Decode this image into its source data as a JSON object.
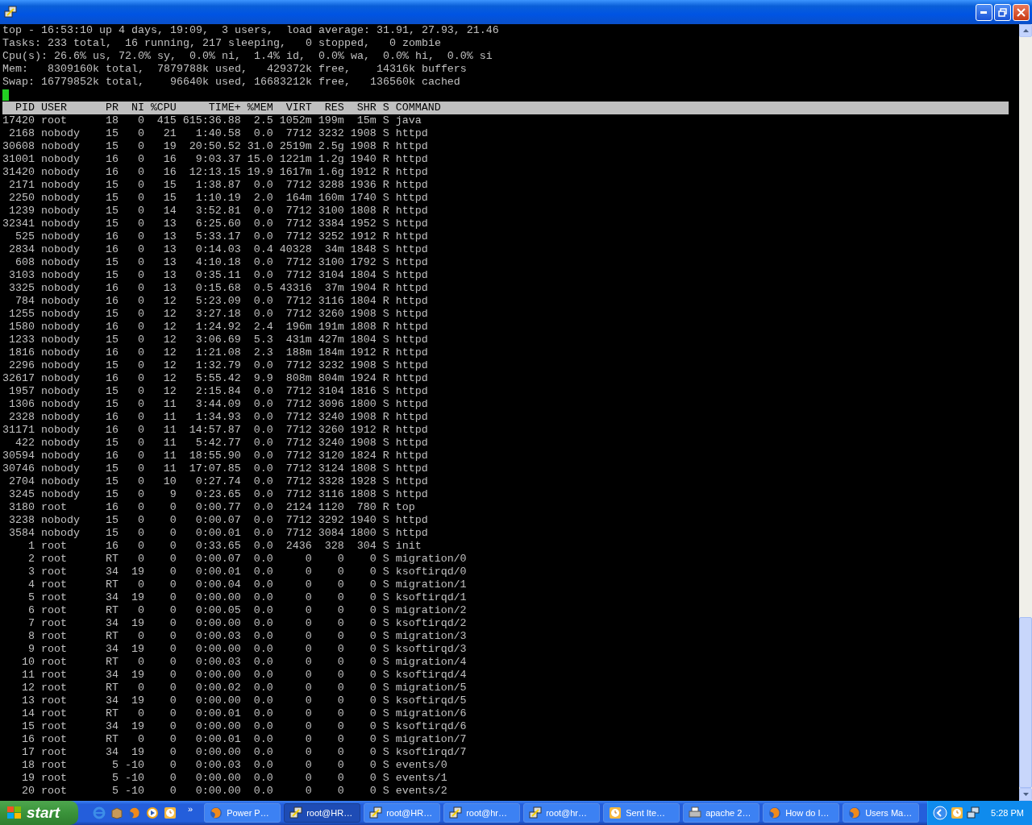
{
  "terminal": {
    "summary": [
      "top - 16:53:10 up 4 days, 19:09,  3 users,  load average: 31.91, 27.93, 21.46",
      "Tasks: 233 total,  16 running, 217 sleeping,   0 stopped,   0 zombie",
      "Cpu(s): 26.6% us, 72.0% sy,  0.0% ni,  1.4% id,  0.0% wa,  0.0% hi,  0.0% si",
      "Mem:   8309160k total,  7879788k used,   429372k free,    14316k buffers",
      "Swap: 16779852k total,    96640k used, 16683212k free,   136560k cached"
    ],
    "table": {
      "columns": [
        "PID",
        "USER",
        "PR",
        "NI",
        "%CPU",
        "TIME+",
        "%MEM",
        "VIRT",
        "RES",
        "SHR",
        "S",
        "COMMAND"
      ],
      "rows": [
        [
          "17420",
          "root",
          "18",
          "0",
          "415",
          "615:36.88",
          "2.5",
          "1052m",
          "199m",
          "15m",
          "S",
          "java"
        ],
        [
          "2168",
          "nobody",
          "15",
          "0",
          "21",
          "1:40.58",
          "0.0",
          "7712",
          "3232",
          "1908",
          "S",
          "httpd"
        ],
        [
          "30608",
          "nobody",
          "15",
          "0",
          "19",
          "20:50.52",
          "31.0",
          "2519m",
          "2.5g",
          "1908",
          "R",
          "httpd"
        ],
        [
          "31001",
          "nobody",
          "16",
          "0",
          "16",
          "9:03.37",
          "15.0",
          "1221m",
          "1.2g",
          "1940",
          "R",
          "httpd"
        ],
        [
          "31420",
          "nobody",
          "16",
          "0",
          "16",
          "12:13.15",
          "19.9",
          "1617m",
          "1.6g",
          "1912",
          "R",
          "httpd"
        ],
        [
          "2171",
          "nobody",
          "15",
          "0",
          "15",
          "1:38.87",
          "0.0",
          "7712",
          "3288",
          "1936",
          "R",
          "httpd"
        ],
        [
          "2250",
          "nobody",
          "15",
          "0",
          "15",
          "1:10.19",
          "2.0",
          "164m",
          "160m",
          "1740",
          "S",
          "httpd"
        ],
        [
          "1239",
          "nobody",
          "15",
          "0",
          "14",
          "3:52.81",
          "0.0",
          "7712",
          "3100",
          "1808",
          "R",
          "httpd"
        ],
        [
          "32341",
          "nobody",
          "15",
          "0",
          "13",
          "6:25.60",
          "0.0",
          "7712",
          "3384",
          "1952",
          "S",
          "httpd"
        ],
        [
          "525",
          "nobody",
          "16",
          "0",
          "13",
          "5:33.17",
          "0.0",
          "7712",
          "3252",
          "1912",
          "R",
          "httpd"
        ],
        [
          "2834",
          "nobody",
          "16",
          "0",
          "13",
          "0:14.03",
          "0.4",
          "40328",
          "34m",
          "1848",
          "S",
          "httpd"
        ],
        [
          "608",
          "nobody",
          "15",
          "0",
          "13",
          "4:10.18",
          "0.0",
          "7712",
          "3100",
          "1792",
          "S",
          "httpd"
        ],
        [
          "3103",
          "nobody",
          "15",
          "0",
          "13",
          "0:35.11",
          "0.0",
          "7712",
          "3104",
          "1804",
          "S",
          "httpd"
        ],
        [
          "3325",
          "nobody",
          "16",
          "0",
          "13",
          "0:15.68",
          "0.5",
          "43316",
          "37m",
          "1904",
          "R",
          "httpd"
        ],
        [
          "784",
          "nobody",
          "16",
          "0",
          "12",
          "5:23.09",
          "0.0",
          "7712",
          "3116",
          "1804",
          "R",
          "httpd"
        ],
        [
          "1255",
          "nobody",
          "15",
          "0",
          "12",
          "3:27.18",
          "0.0",
          "7712",
          "3260",
          "1908",
          "S",
          "httpd"
        ],
        [
          "1580",
          "nobody",
          "16",
          "0",
          "12",
          "1:24.92",
          "2.4",
          "196m",
          "191m",
          "1808",
          "R",
          "httpd"
        ],
        [
          "1233",
          "nobody",
          "15",
          "0",
          "12",
          "3:06.69",
          "5.3",
          "431m",
          "427m",
          "1804",
          "S",
          "httpd"
        ],
        [
          "1816",
          "nobody",
          "16",
          "0",
          "12",
          "1:21.08",
          "2.3",
          "188m",
          "184m",
          "1912",
          "R",
          "httpd"
        ],
        [
          "2296",
          "nobody",
          "15",
          "0",
          "12",
          "1:32.79",
          "0.0",
          "7712",
          "3232",
          "1908",
          "S",
          "httpd"
        ],
        [
          "32617",
          "nobody",
          "16",
          "0",
          "12",
          "5:55.42",
          "9.9",
          "808m",
          "804m",
          "1924",
          "R",
          "httpd"
        ],
        [
          "1957",
          "nobody",
          "15",
          "0",
          "12",
          "2:15.84",
          "0.0",
          "7712",
          "3104",
          "1816",
          "S",
          "httpd"
        ],
        [
          "1306",
          "nobody",
          "15",
          "0",
          "11",
          "3:44.09",
          "0.0",
          "7712",
          "3096",
          "1800",
          "S",
          "httpd"
        ],
        [
          "2328",
          "nobody",
          "16",
          "0",
          "11",
          "1:34.93",
          "0.0",
          "7712",
          "3240",
          "1908",
          "R",
          "httpd"
        ],
        [
          "31171",
          "nobody",
          "16",
          "0",
          "11",
          "14:57.87",
          "0.0",
          "7712",
          "3260",
          "1912",
          "R",
          "httpd"
        ],
        [
          "422",
          "nobody",
          "15",
          "0",
          "11",
          "5:42.77",
          "0.0",
          "7712",
          "3240",
          "1908",
          "S",
          "httpd"
        ],
        [
          "30594",
          "nobody",
          "16",
          "0",
          "11",
          "18:55.90",
          "0.0",
          "7712",
          "3120",
          "1824",
          "R",
          "httpd"
        ],
        [
          "30746",
          "nobody",
          "15",
          "0",
          "11",
          "17:07.85",
          "0.0",
          "7712",
          "3124",
          "1808",
          "S",
          "httpd"
        ],
        [
          "2704",
          "nobody",
          "15",
          "0",
          "10",
          "0:27.74",
          "0.0",
          "7712",
          "3328",
          "1928",
          "S",
          "httpd"
        ],
        [
          "3245",
          "nobody",
          "15",
          "0",
          "9",
          "0:23.65",
          "0.0",
          "7712",
          "3116",
          "1808",
          "S",
          "httpd"
        ],
        [
          "3180",
          "root",
          "16",
          "0",
          "0",
          "0:00.77",
          "0.0",
          "2124",
          "1120",
          "780",
          "R",
          "top"
        ],
        [
          "3238",
          "nobody",
          "15",
          "0",
          "0",
          "0:00.07",
          "0.0",
          "7712",
          "3292",
          "1940",
          "S",
          "httpd"
        ],
        [
          "3584",
          "nobody",
          "15",
          "0",
          "0",
          "0:00.01",
          "0.0",
          "7712",
          "3084",
          "1800",
          "S",
          "httpd"
        ],
        [
          "1",
          "root",
          "16",
          "0",
          "0",
          "0:33.65",
          "0.0",
          "2436",
          "328",
          "304",
          "S",
          "init"
        ],
        [
          "2",
          "root",
          "RT",
          "0",
          "0",
          "0:00.07",
          "0.0",
          "0",
          "0",
          "0",
          "S",
          "migration/0"
        ],
        [
          "3",
          "root",
          "34",
          "19",
          "0",
          "0:00.01",
          "0.0",
          "0",
          "0",
          "0",
          "S",
          "ksoftirqd/0"
        ],
        [
          "4",
          "root",
          "RT",
          "0",
          "0",
          "0:00.04",
          "0.0",
          "0",
          "0",
          "0",
          "S",
          "migration/1"
        ],
        [
          "5",
          "root",
          "34",
          "19",
          "0",
          "0:00.00",
          "0.0",
          "0",
          "0",
          "0",
          "S",
          "ksoftirqd/1"
        ],
        [
          "6",
          "root",
          "RT",
          "0",
          "0",
          "0:00.05",
          "0.0",
          "0",
          "0",
          "0",
          "S",
          "migration/2"
        ],
        [
          "7",
          "root",
          "34",
          "19",
          "0",
          "0:00.00",
          "0.0",
          "0",
          "0",
          "0",
          "S",
          "ksoftirqd/2"
        ],
        [
          "8",
          "root",
          "RT",
          "0",
          "0",
          "0:00.03",
          "0.0",
          "0",
          "0",
          "0",
          "S",
          "migration/3"
        ],
        [
          "9",
          "root",
          "34",
          "19",
          "0",
          "0:00.00",
          "0.0",
          "0",
          "0",
          "0",
          "S",
          "ksoftirqd/3"
        ],
        [
          "10",
          "root",
          "RT",
          "0",
          "0",
          "0:00.03",
          "0.0",
          "0",
          "0",
          "0",
          "S",
          "migration/4"
        ],
        [
          "11",
          "root",
          "34",
          "19",
          "0",
          "0:00.00",
          "0.0",
          "0",
          "0",
          "0",
          "S",
          "ksoftirqd/4"
        ],
        [
          "12",
          "root",
          "RT",
          "0",
          "0",
          "0:00.02",
          "0.0",
          "0",
          "0",
          "0",
          "S",
          "migration/5"
        ],
        [
          "13",
          "root",
          "34",
          "19",
          "0",
          "0:00.00",
          "0.0",
          "0",
          "0",
          "0",
          "S",
          "ksoftirqd/5"
        ],
        [
          "14",
          "root",
          "RT",
          "0",
          "0",
          "0:00.01",
          "0.0",
          "0",
          "0",
          "0",
          "S",
          "migration/6"
        ],
        [
          "15",
          "root",
          "34",
          "19",
          "0",
          "0:00.00",
          "0.0",
          "0",
          "0",
          "0",
          "S",
          "ksoftirqd/6"
        ],
        [
          "16",
          "root",
          "RT",
          "0",
          "0",
          "0:00.01",
          "0.0",
          "0",
          "0",
          "0",
          "S",
          "migration/7"
        ],
        [
          "17",
          "root",
          "34",
          "19",
          "0",
          "0:00.00",
          "0.0",
          "0",
          "0",
          "0",
          "S",
          "ksoftirqd/7"
        ],
        [
          "18",
          "root",
          "5",
          "-10",
          "0",
          "0:00.03",
          "0.0",
          "0",
          "0",
          "0",
          "S",
          "events/0"
        ],
        [
          "19",
          "root",
          "5",
          "-10",
          "0",
          "0:00.00",
          "0.0",
          "0",
          "0",
          "0",
          "S",
          "events/1"
        ],
        [
          "20",
          "root",
          "5",
          "-10",
          "0",
          "0:00.00",
          "0.0",
          "0",
          "0",
          "0",
          "S",
          "events/2"
        ]
      ]
    }
  },
  "taskbar": {
    "start": "start",
    "quick_launch": [
      {
        "kind": "ie"
      },
      {
        "kind": "box"
      },
      {
        "kind": "firefox"
      },
      {
        "kind": "player"
      },
      {
        "kind": "calendar"
      }
    ],
    "more": "»",
    "tasks": [
      {
        "kind": "firefox",
        "label": "Power P…",
        "selected": false
      },
      {
        "kind": "putty",
        "label": "root@HR…",
        "selected": true
      },
      {
        "kind": "putty",
        "label": "root@HR…",
        "selected": false
      },
      {
        "kind": "putty",
        "label": "root@hr…",
        "selected": false
      },
      {
        "kind": "putty",
        "label": "root@hr…",
        "selected": false
      },
      {
        "kind": "calendar",
        "label": "Sent Ite…",
        "selected": false
      },
      {
        "kind": "printer",
        "label": "apache 2…",
        "selected": false
      },
      {
        "kind": "firefox",
        "label": "How do I…",
        "selected": false
      },
      {
        "kind": "firefox",
        "label": "Users Ma…",
        "selected": false
      }
    ],
    "clock": "5:28 PM"
  }
}
